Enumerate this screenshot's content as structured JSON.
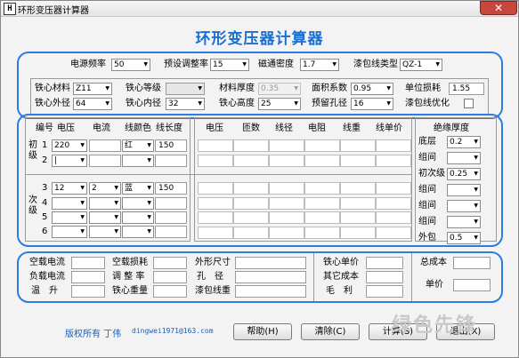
{
  "window": {
    "title": "环形变压器计算器",
    "close": "✕",
    "app_icon": "H"
  },
  "heading": "环形变压器计算器",
  "top_settings": [
    {
      "label": "电源频率",
      "value": "50"
    },
    {
      "label": "预设调整率",
      "value": "15"
    },
    {
      "label": "磁通密度",
      "value": "1.7"
    },
    {
      "label": "漆包线类型",
      "value": "QZ-1"
    }
  ],
  "core": {
    "material_label": "铁心材料",
    "material_value": "Z11",
    "grade_label": "铁心等级",
    "grade_value": "",
    "thickness_label": "材料厚度",
    "thickness_value": "0.35",
    "area_coef_label": "面积系数",
    "area_coef_value": "0.95",
    "unit_loss_label": "单位损耗",
    "unit_loss_value": "1.55",
    "outer_label": "铁心外径",
    "outer_value": "64",
    "inner_label": "铁心内径",
    "inner_value": "32",
    "height_label": "铁心高度",
    "height_value": "25",
    "hole_label": "预留孔径",
    "hole_value": "16",
    "optimize_label": "漆包线优化"
  },
  "winding_table": {
    "headers_left": [
      "编号",
      "电压",
      "电流",
      "线颜色",
      "线长度"
    ],
    "headers_right": [
      "电压",
      "匝数",
      "线径",
      "电阻",
      "线重",
      "线单价"
    ],
    "primary_label": "初级",
    "secondary_label": "次级",
    "primary_rows": [
      {
        "num": "1",
        "voltage": "220",
        "current": "",
        "color": "红",
        "length": "150"
      },
      {
        "num": "2",
        "voltage": "|",
        "current": "",
        "color": "",
        "length": ""
      }
    ],
    "secondary_rows": [
      {
        "num": "3",
        "voltage": "12",
        "current": "2",
        "color": "蓝",
        "length": "150"
      },
      {
        "num": "4",
        "voltage": "",
        "current": "",
        "color": "",
        "length": ""
      },
      {
        "num": "5",
        "voltage": "",
        "current": "",
        "color": "",
        "length": ""
      },
      {
        "num": "6",
        "voltage": "",
        "current": "",
        "color": "",
        "length": ""
      }
    ]
  },
  "insulation": {
    "title": "绝缘厚度",
    "rows": [
      {
        "label": "底层",
        "value": "0.2"
      },
      {
        "label": "组间",
        "value": ""
      },
      {
        "label": "初次级",
        "value": "0.25"
      },
      {
        "label": "组间",
        "value": ""
      },
      {
        "label": "组间",
        "value": ""
      },
      {
        "label": "组间",
        "value": ""
      },
      {
        "label": "外包",
        "value": "0.5"
      }
    ]
  },
  "results": {
    "noload_current": "空载电流",
    "load_current": "负载电流",
    "temp_rise": "温　升",
    "noload_loss": "空载损耗",
    "regulation": "调 整 率",
    "core_weight": "铁心重量",
    "outer_size": "外形尺寸",
    "hole_diameter": "孔　径",
    "wire_weight": "漆包线重",
    "core_unit_price": "铁心单价",
    "other_cost": "其它成本",
    "gross_profit": "毛　利",
    "total_cost": "总成本",
    "unit_price": "单价"
  },
  "footer": {
    "copyright": "版权所有 丁伟",
    "email": "dingwei1971@163.com",
    "help": "帮助(H)",
    "clear": "清除(C)",
    "calc": "计算(S)",
    "exit": "退出(X)",
    "watermark": "绿色先锋"
  }
}
